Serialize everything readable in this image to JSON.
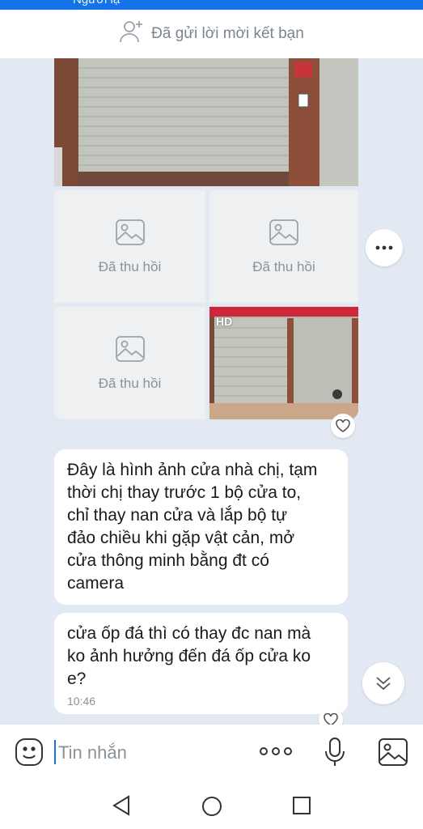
{
  "header": {
    "partial_title": "Người lạ",
    "friend_request_status": "Đã gửi lời mời kết bạn",
    "friend_icon": "add-person-icon"
  },
  "messages": {
    "photo_group": {
      "recalled_label": "Đã thu hồi",
      "recalled_tiles": [
        "Đã thu hồi",
        "Đã thu hồi",
        "Đã thu hồi"
      ],
      "hd_badge": "HD"
    },
    "bubble_1": {
      "lines": [
        "Đây là hình ảnh cửa nhà chị, tạm",
        "thời chị thay trước 1 bộ cửa to,",
        "chỉ thay nan cửa và lắp bộ tự",
        "đảo chiều khi gặp vật cản, mở",
        "cửa thông minh bằng đt có",
        "camera"
      ]
    },
    "bubble_2": {
      "lines": [
        "cửa ốp đá thì có thay đc nan mà",
        "ko ảnh hưởng đến đá ốp cửa ko",
        "e?"
      ],
      "time": "10:46"
    }
  },
  "input_bar": {
    "placeholder": "Tin nhắn",
    "icons": [
      "emoji-icon",
      "more-dots-icon",
      "microphone-icon",
      "image-icon"
    ]
  },
  "colors": {
    "accent": "#1573e8",
    "background": "#e2e9f3",
    "muted_text": "#8a929b"
  }
}
